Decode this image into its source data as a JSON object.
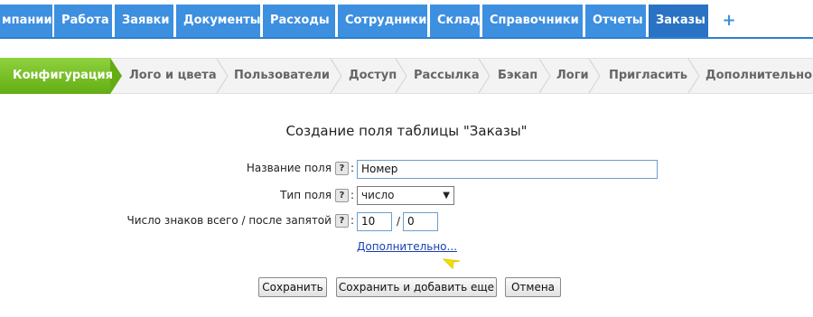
{
  "topnav": {
    "tabs": [
      {
        "label": "мпании"
      },
      {
        "label": "Работа"
      },
      {
        "label": "Заявки"
      },
      {
        "label": "Документы"
      },
      {
        "label": "Расходы"
      },
      {
        "label": "Сотрудники"
      },
      {
        "label": "Склад"
      },
      {
        "label": "Справочники"
      },
      {
        "label": "Отчеты"
      },
      {
        "label": "Заказы"
      }
    ],
    "add_label": "+"
  },
  "steps": {
    "active": "Конфигурация",
    "items": [
      "Лого и цвета",
      "Пользователи",
      "Доступ",
      "Рассылка",
      "Бэкап",
      "Логи",
      "Пригласить",
      "Дополнительно"
    ]
  },
  "form": {
    "title": "Создание поля таблицы \"Заказы\"",
    "name_label": "Название поля",
    "name_value": "Номер",
    "type_label": "Тип поля",
    "type_value": "число",
    "digits_label": "Число знаков всего / после запятой",
    "digits_total": "10",
    "digits_decimal": "0",
    "slash": "/",
    "colon": ":",
    "help_glyph": "?",
    "more_link": "Дополнительно...",
    "buttons": {
      "save": "Сохранить",
      "save_add": "Сохранить и добавить еще",
      "cancel": "Отмена"
    }
  },
  "colors": {
    "tab_blue": "#3d8fe0",
    "active_green": "#6cb81b",
    "link_blue": "#1a3fb0",
    "cursor_yellow": "#f2e100"
  }
}
